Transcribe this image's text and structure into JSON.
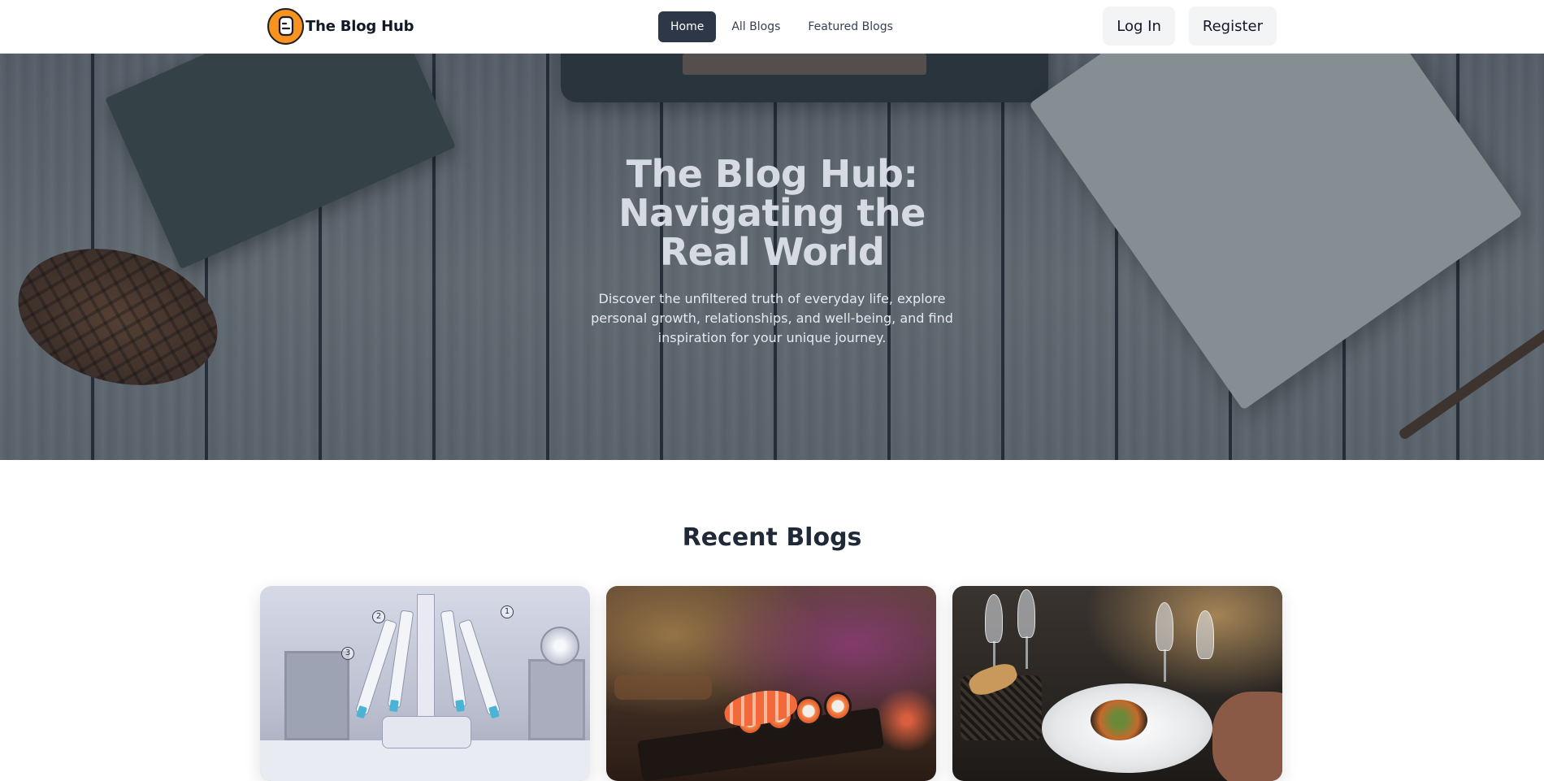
{
  "header": {
    "brand_name": "The Blog Hub",
    "nav": [
      {
        "label": "Home",
        "active": true
      },
      {
        "label": "All Blogs",
        "active": false
      },
      {
        "label": "Featured Blogs",
        "active": false
      }
    ],
    "login_label": "Log In",
    "register_label": "Register"
  },
  "hero": {
    "title": "The Blog Hub: Navigating the Real World",
    "subtitle": "Discover the unfiltered truth of everyday life, explore personal growth, relationships, and well-being, and find inspiration for your unique journey."
  },
  "recent": {
    "title": "Recent Blogs",
    "cards": [
      {
        "image": "robotic-surgery-photo"
      },
      {
        "image": "sushi-photo"
      },
      {
        "image": "fine-dining-photo"
      }
    ]
  },
  "colors": {
    "brand_logo": "#f7931e",
    "nav_active": "#2d3748",
    "auth_button_bg": "#f3f4f6",
    "hero_title": "#d6dbe3"
  }
}
